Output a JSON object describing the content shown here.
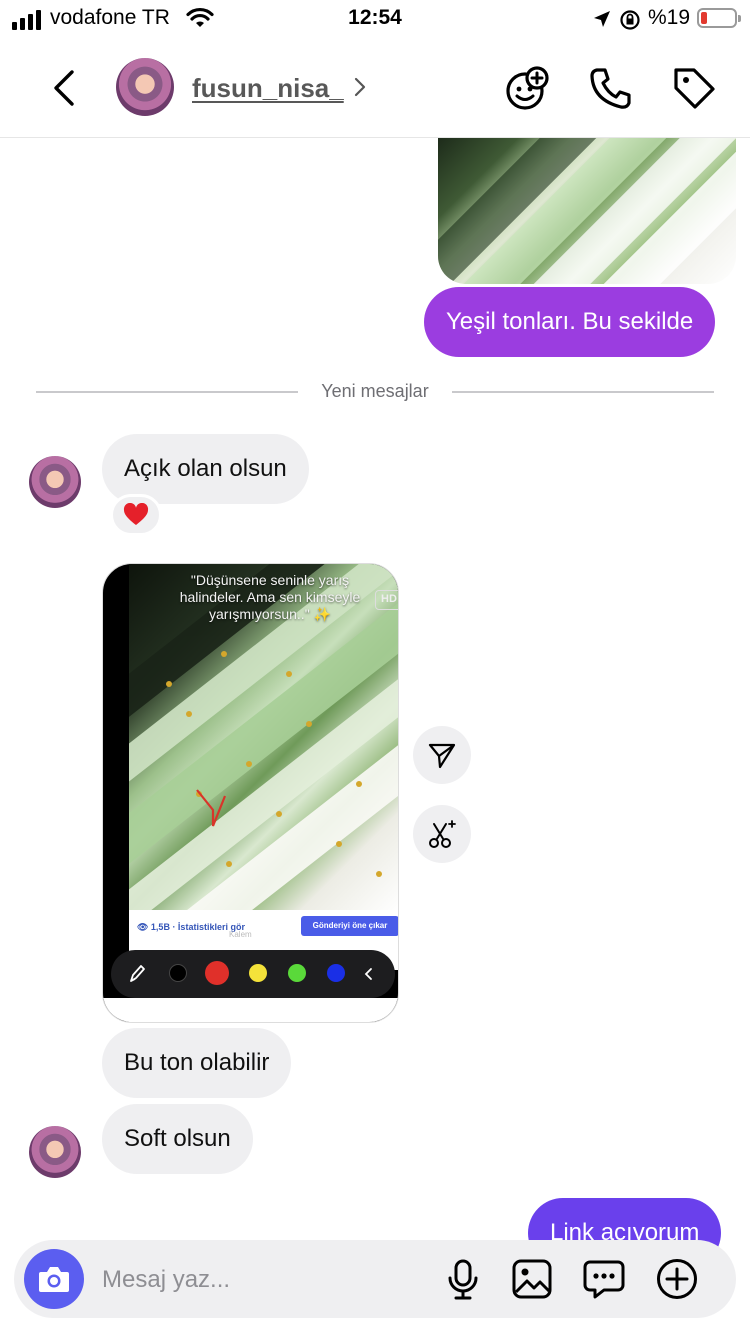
{
  "status_bar": {
    "carrier": "vodafone TR",
    "time": "12:54",
    "battery": "%19",
    "battery_level": 0.19
  },
  "header": {
    "username": "fusun_nisa_",
    "icons": [
      "back-icon",
      "effects-icon",
      "phone-icon",
      "tag-icon"
    ]
  },
  "messages": {
    "sent_text_1": "Yeşil tonları. Bu sekilde",
    "divider_label": "Yeni mesajlar",
    "received_1": "Açık olan olsun",
    "reaction": "❤️",
    "shared_screenshot": {
      "caption": "\"Düşünsene seninle yarış halindeler. Ama sen kimseyle yarışmıyorsun..\" ✨",
      "hd_badge": "HD",
      "stats_link": "👁 1,5B · İstatistikleri gör",
      "pen_hint": "Kalem",
      "promote_button": "Gönderiyi öne çıkar",
      "palette": [
        "#000000",
        "#e0302a",
        "#f4e23a",
        "#5ad93a",
        "#1a2fe6"
      ]
    },
    "received_2": "Bu ton olabilir",
    "received_3": "Soft olsun",
    "sent_text_2": "Link açıyorum"
  },
  "composer": {
    "placeholder": "Mesaj yaz...",
    "icons": [
      "camera-icon",
      "microphone-icon",
      "gallery-icon",
      "sticker-icon",
      "plus-icon"
    ]
  }
}
